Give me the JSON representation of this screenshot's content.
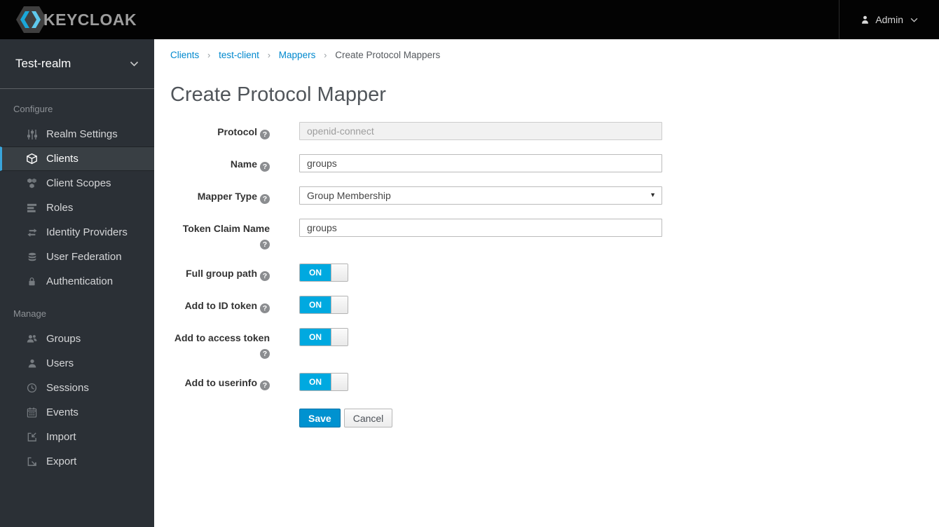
{
  "header": {
    "logo_text": "KEYCLOAK",
    "user_label": "Admin"
  },
  "sidebar": {
    "realm": "Test-realm",
    "sections": [
      {
        "label": "Configure",
        "items": [
          {
            "label": "Realm Settings",
            "icon": "sliders-icon",
            "active": false
          },
          {
            "label": "Clients",
            "icon": "cube-icon",
            "active": true
          },
          {
            "label": "Client Scopes",
            "icon": "cubes-icon",
            "active": false
          },
          {
            "label": "Roles",
            "icon": "list-icon",
            "active": false
          },
          {
            "label": "Identity Providers",
            "icon": "exchange-icon",
            "active": false
          },
          {
            "label": "User Federation",
            "icon": "database-icon",
            "active": false
          },
          {
            "label": "Authentication",
            "icon": "lock-icon",
            "active": false
          }
        ]
      },
      {
        "label": "Manage",
        "items": [
          {
            "label": "Groups",
            "icon": "users-icon",
            "active": false
          },
          {
            "label": "Users",
            "icon": "user-icon",
            "active": false
          },
          {
            "label": "Sessions",
            "icon": "clock-icon",
            "active": false
          },
          {
            "label": "Events",
            "icon": "calendar-icon",
            "active": false
          },
          {
            "label": "Import",
            "icon": "import-icon",
            "active": false
          },
          {
            "label": "Export",
            "icon": "export-icon",
            "active": false
          }
        ]
      }
    ]
  },
  "breadcrumb": {
    "items": [
      "Clients",
      "test-client",
      "Mappers",
      "Create Protocol Mappers"
    ]
  },
  "page": {
    "title": "Create Protocol Mapper"
  },
  "form": {
    "fields": [
      {
        "label": "Protocol",
        "type": "text",
        "value": "openid-connect",
        "disabled": true
      },
      {
        "label": "Name",
        "type": "text",
        "value": "groups",
        "disabled": false
      },
      {
        "label": "Mapper Type",
        "type": "select",
        "value": "Group Membership"
      },
      {
        "label": "Token Claim Name",
        "type": "text",
        "value": "groups",
        "disabled": false
      },
      {
        "label": "Full group path",
        "type": "toggle",
        "value": "ON"
      },
      {
        "label": "Add to ID token",
        "type": "toggle",
        "value": "ON"
      },
      {
        "label": "Add to access token",
        "type": "toggle",
        "value": "ON"
      },
      {
        "label": "Add to userinfo",
        "type": "toggle",
        "value": "ON"
      }
    ],
    "save_label": "Save",
    "cancel_label": "Cancel"
  },
  "icons": {
    "help_glyph": "?",
    "breadcrumb_separator": "›",
    "select_caret": "▼"
  },
  "colors": {
    "header_bg": "#030303",
    "sidebar_bg": "#2b3036",
    "sidebar_active_bg": "#393f44",
    "sidebar_active_border": "#39a5dc",
    "link_blue": "#0088ce",
    "toggle_blue": "#00a9e0",
    "save_blue": "#0092d0"
  }
}
